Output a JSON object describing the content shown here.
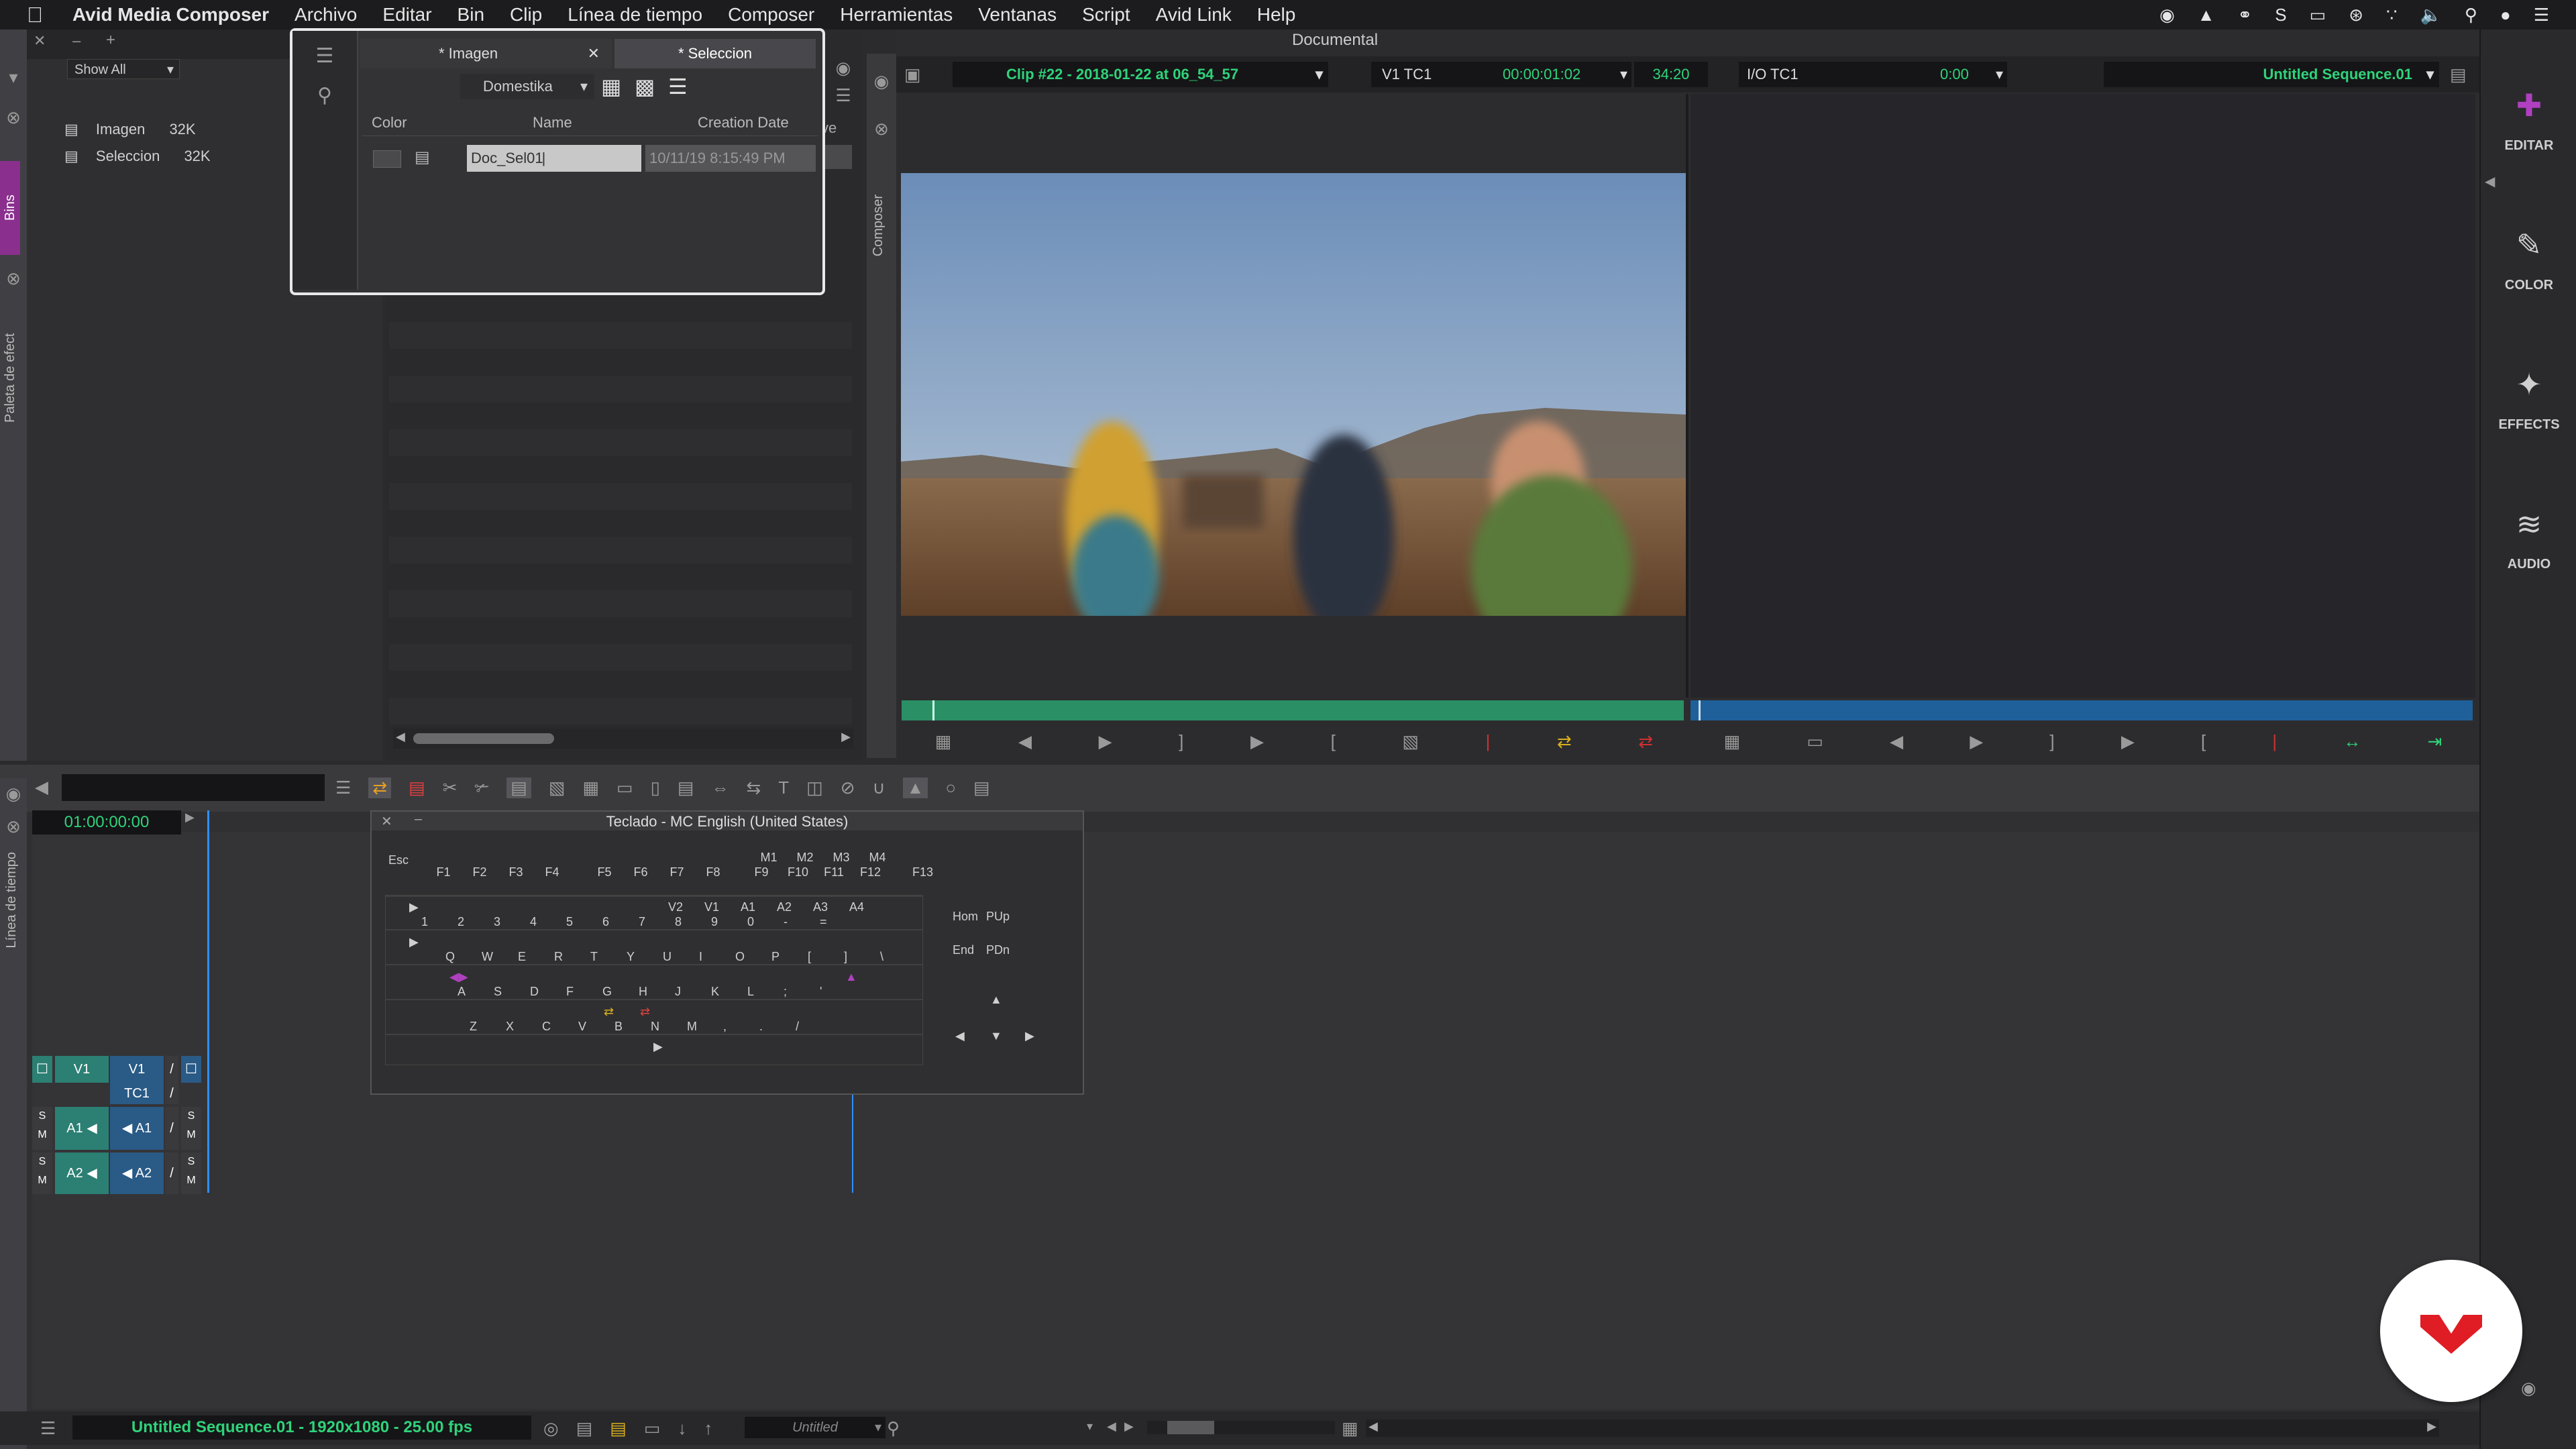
{
  "menubar": {
    "app": "Avid Media Composer",
    "items": [
      "Archivo",
      "Editar",
      "Bin",
      "Clip",
      "Línea de tiempo",
      "Composer",
      "Herramientas",
      "Ventanas",
      "Script",
      "Avid Link",
      "Help"
    ]
  },
  "window_title": "Documental",
  "project": {
    "filter": "Show All",
    "bins": [
      {
        "name": "Imagen",
        "size": "32K"
      },
      {
        "name": "Seleccion",
        "size": "32K"
      }
    ],
    "side_tabs": {
      "bins": "Bins",
      "paleta": "Paleta de efect"
    }
  },
  "bin": {
    "tabs": [
      "* Imagen",
      "* Seleccion"
    ],
    "view_select": "Domestika",
    "columns": [
      "Color",
      "Name",
      "Creation Date"
    ],
    "rows": [
      {
        "name": "Doc_Sel01",
        "date": "10/11/19 8:15:49 PM"
      }
    ],
    "stray_text": "ve"
  },
  "composer": {
    "strip_label": "Composer",
    "clip_name": "Clip #22 - 2018-01-22 at 06_54_57",
    "track_display": "V1  TC1",
    "timecode": "00:00:01:02",
    "duration": "34:20",
    "io_label": "I/O  TC1",
    "io_value": "0:00",
    "sequence": "Untitled Sequence.01",
    "source_progress": 1.0
  },
  "right_tools": [
    {
      "label": "EDITAR",
      "icon": "edit-icon"
    },
    {
      "label": "COLOR",
      "icon": "color-icon"
    },
    {
      "label": "EFFECTS",
      "icon": "effects-icon"
    },
    {
      "label": "AUDIO",
      "icon": "audio-icon"
    }
  ],
  "timeline": {
    "timecode": "01:00:00:00",
    "side_tab": "Línea de tiempo",
    "tracks": {
      "video": [
        "V1",
        "V1"
      ],
      "tc": "TC1",
      "audio": [
        [
          "A1",
          "A1"
        ],
        [
          "A2",
          "A2"
        ]
      ],
      "solo": "S",
      "mute": "M"
    },
    "status_sequence": "Untitled Sequence.01 - 1920x1080 - 25.00 fps",
    "status_select": "Untitled"
  },
  "keyboard": {
    "title": "Teclado - MC English (United States)",
    "fn_keys": [
      "Esc",
      "F1",
      "F2",
      "F3",
      "F4",
      "F5",
      "F6",
      "F7",
      "F8",
      "M1",
      "M2",
      "M3",
      "M4",
      "F9",
      "F10",
      "F11",
      "F12",
      "F13"
    ],
    "num_row": [
      "1",
      "2",
      "3",
      "4",
      "5",
      "6",
      "7",
      "8",
      "9",
      "0",
      "-",
      "="
    ],
    "num_row_labels": [
      "V2",
      "V1",
      "A1",
      "A2",
      "A3",
      "A4"
    ],
    "q_row": [
      "Q",
      "W",
      "E",
      "R",
      "T",
      "Y",
      "U",
      "I",
      "O",
      "P",
      "[",
      "]",
      "\\"
    ],
    "a_row": [
      "A",
      "S",
      "D",
      "F",
      "G",
      "H",
      "J",
      "K",
      "L",
      ";",
      "'"
    ],
    "z_row": [
      "Z",
      "X",
      "C",
      "V",
      "B",
      "N",
      "M",
      ",",
      ".",
      "/"
    ],
    "nav_keys": [
      "Hom",
      "PUp",
      "End",
      "PDn"
    ]
  },
  "colors": {
    "accent_green": "#2fd37a",
    "timeline_teal": "#2b7f73",
    "bins_tab": "#8a2f8e",
    "track_blue": "#2a5a86"
  }
}
